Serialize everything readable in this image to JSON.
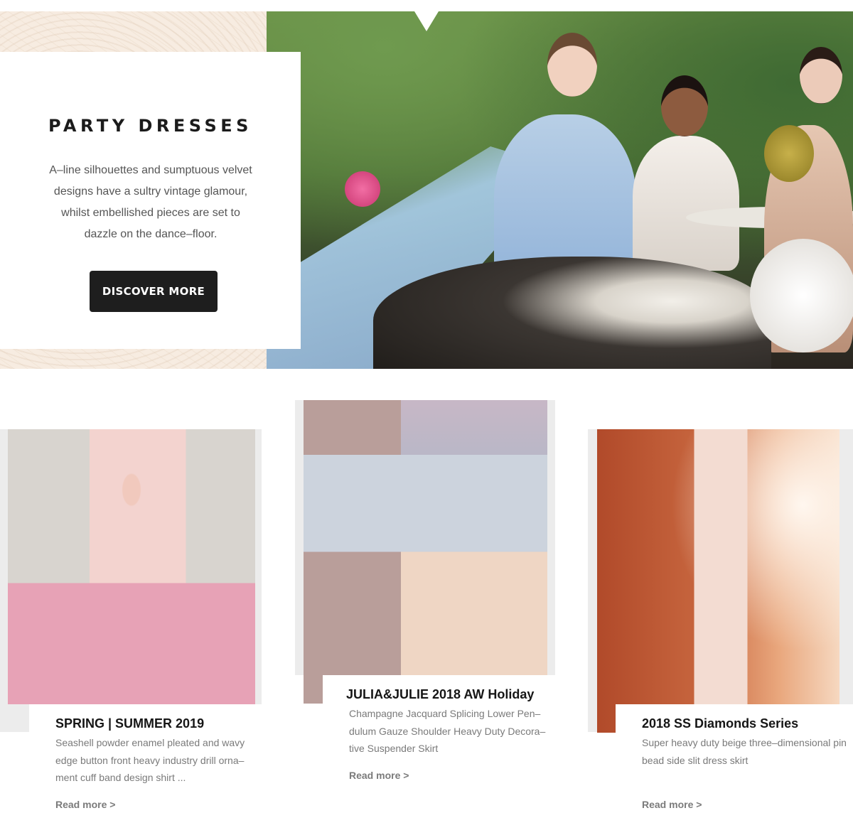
{
  "hero": {
    "title": "PARTY DRESSES",
    "description": "A–line silhouettes and sumptuous velvet designs have a sultry vintage glamour, whilst embellished pieces are set to dazzle on the dance–floor.",
    "button_label": "DISCOVER MORE"
  },
  "cards": [
    {
      "title": "SPRING | SUMMER 2019",
      "description": "Seashell powder enamel pleated and wavy edge button front heavy industry drill orna–ment cuff band design shirt ...",
      "link_label": "Read more >"
    },
    {
      "title": "JULIA&JULIE 2018 AW Holiday",
      "description": "Champagne Jacquard Splicing Lower Pen–dulum Gauze Shoulder Heavy Duty Decora–tive Suspender Skirt",
      "link_label": "Read more >"
    },
    {
      "title": "2018 SS Diamonds Series",
      "description": "Super heavy duty beige three–dimensional pin bead side slit dress skirt",
      "link_label": "Read more >"
    }
  ],
  "colors": {
    "button_bg": "#1e1e1e",
    "pattern_bg": "#f7ece1",
    "card_shadow_bg": "#ececec"
  }
}
